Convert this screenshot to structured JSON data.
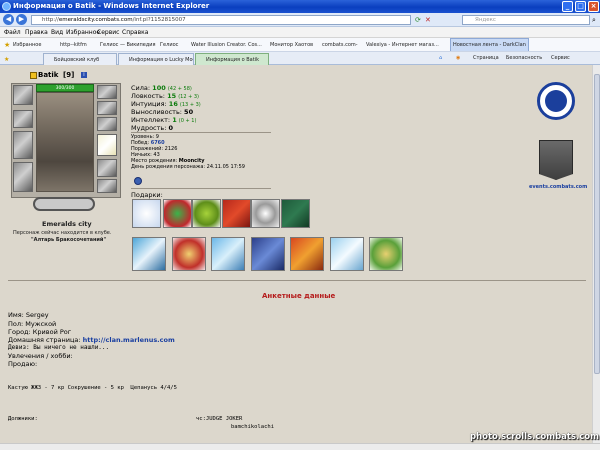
{
  "window": {
    "title": "Информация о Batik - Windows Internet Explorer"
  },
  "address": {
    "prefix": "http://",
    "domain": "emeraldscity.combats.com",
    "path": "/inf.pl?1152815007",
    "search_placeholder": "Яндекс"
  },
  "menu": [
    "Файл",
    "Правка",
    "Вид",
    "Избранное",
    "Сервис",
    "Справка"
  ],
  "favorites": {
    "label": "Избранное",
    "items": [
      "http--kitfm",
      "Гелиос — Википедия",
      "Гелиос",
      "Water Illusion Creator. Cos...",
      "Монитор Хаотов",
      "combats.com-",
      "Valexiya - Интернет магаз...",
      "Новостная лента - DarkClan"
    ]
  },
  "tabs": [
    "Бойцовский клуб",
    "Информация о Lucky Moon",
    "Информация о Batik"
  ],
  "commands": [
    "Страница",
    "Безопасность",
    "Сервис"
  ],
  "character": {
    "name": "Batik",
    "level": "[9]",
    "hp": "300/300",
    "city": "Emeralds city",
    "location_line1": "Персонаж сейчас находится в клубе.",
    "location_line2": "\"Алтарь Бракосочетаний\""
  },
  "stats": {
    "strength_label": "Сила:",
    "strength": "100",
    "strength_note": "(42 + 58)",
    "agility_label": "Ловкость:",
    "agility": "15",
    "agility_note": "(12 + 3)",
    "intuition_label": "Интуиция:",
    "intuition": "16",
    "intuition_note": "(13 + 3)",
    "endurance_label": "Выносливость:",
    "endurance": "50",
    "intellect_label": "Интеллект:",
    "intellect": "1",
    "intellect_note": "(0 + 1)",
    "wisdom_label": "Мудрость:",
    "wisdom": "0"
  },
  "details": {
    "level": "Уровень: 9",
    "wins_label": "Побед:",
    "wins": "6760",
    "losses": "Поражений: 2126",
    "draws": "Ничьих: 43",
    "birthplace_label": "Место рождения:",
    "birthplace": "Mooncity",
    "birthday": "День рождения персонажа: 24.11.05 17:59"
  },
  "gifts_label": "Подарки:",
  "clan": {
    "link": "events.combats.com"
  },
  "profile": {
    "heading": "Анкетные данные",
    "name": "Имя: Sergey",
    "gender": "Пол: Мужской",
    "city": "Город: Кривой Рог",
    "homepage_label": "Домашняя страница:",
    "homepage_url": "http://clan.marlenus.com",
    "motto": "Девиз: Вы ничего не нашли...",
    "hobbies": "Увлечения / хобби:",
    "sell": "Продаю:",
    "line1": "Кастую ЖЖЗ - 7 кр Сокрушение - 5 кр  Цепанусь 4/4/5",
    "debtors": "Должники:",
    "debtors_right": "чс:JUDGE JOKER",
    "debtors_right2": "bamchikolachi"
  },
  "watermark": "photo.scrolls.combats.com"
}
